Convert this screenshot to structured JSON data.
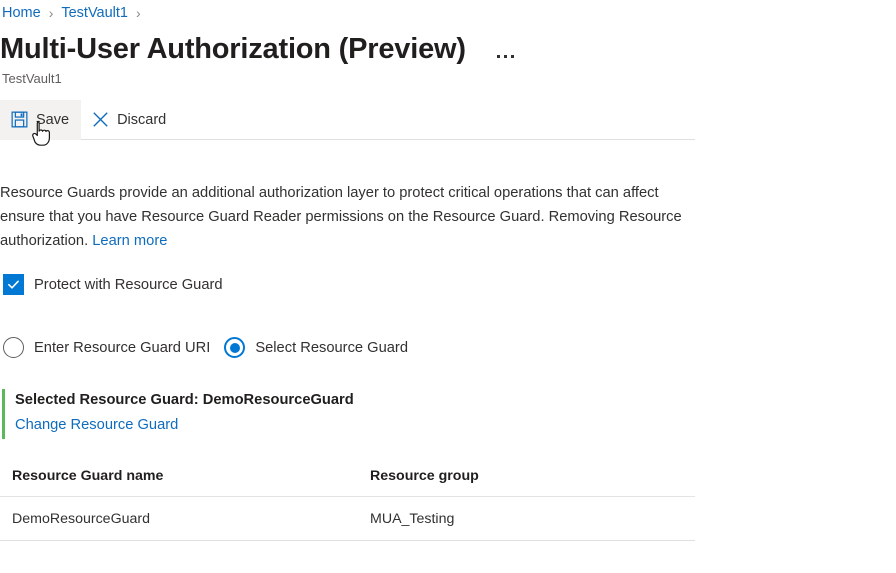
{
  "breadcrumb": {
    "items": [
      {
        "label": "Home"
      },
      {
        "label": "TestVault1"
      }
    ],
    "separator": "›"
  },
  "header": {
    "title": "Multi-User Authorization (Preview)",
    "subtitle": "TestVault1",
    "more_label": "…"
  },
  "toolbar": {
    "save_label": "Save",
    "discard_label": "Discard"
  },
  "description": {
    "part1": "Resource Guards provide an additional authorization layer to protect critical operations that can affect ensure that you have Resource Guard Reader permissions on the Resource Guard. Removing Resource authorization. ",
    "learn_more": "Learn more"
  },
  "protect_checkbox": {
    "label": "Protect with Resource Guard",
    "checked": true
  },
  "guard_mode": {
    "options": [
      {
        "label": "Enter Resource Guard URI",
        "selected": false
      },
      {
        "label": "Select Resource Guard",
        "selected": true
      }
    ]
  },
  "selected_guard": {
    "title": "Selected Resource Guard: DemoResourceGuard",
    "change_link": "Change Resource Guard",
    "accent_color": "#5cb85c"
  },
  "guard_table": {
    "columns": [
      "Resource Guard name",
      "Resource group"
    ],
    "rows": [
      {
        "name": "DemoResourceGuard",
        "group": "MUA_Testing"
      }
    ]
  },
  "colors": {
    "link": "#0f6cbd",
    "accent_blue": "#0078d4",
    "text": "#323130",
    "muted": "#605e5c"
  }
}
